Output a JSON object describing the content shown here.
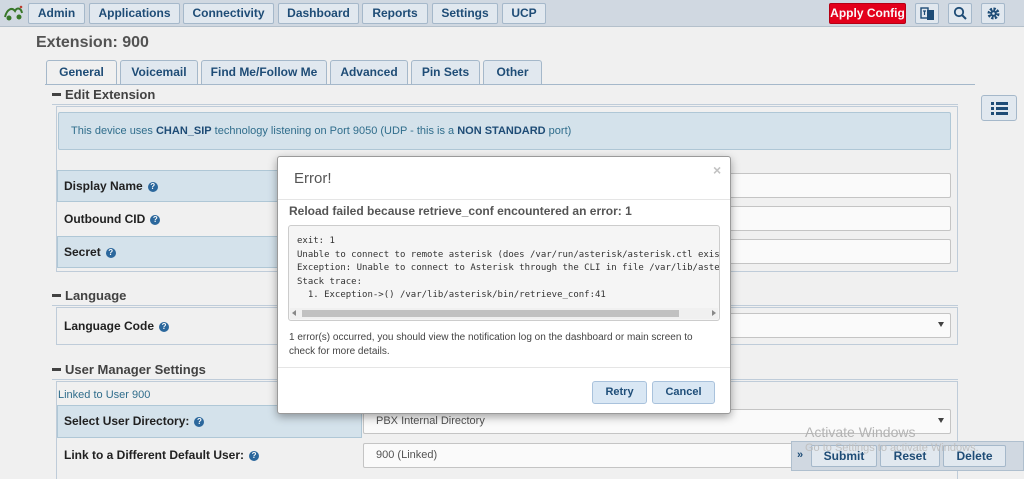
{
  "nav": {
    "items": [
      "Admin",
      "Applications",
      "Connectivity",
      "Dashboard",
      "Reports",
      "Settings",
      "UCP"
    ],
    "apply": "Apply Config"
  },
  "page": {
    "title": "Extension: 900"
  },
  "tabs": [
    "General",
    "Voicemail",
    "Find Me/Follow Me",
    "Advanced",
    "Pin Sets",
    "Other"
  ],
  "edit": {
    "heading": "Edit Extension",
    "info_pre": "This device uses ",
    "info_tech": "CHAN_SIP",
    "info_mid": " technology listening on Port 9050 (UDP - this is a ",
    "info_nonstd": "NON STANDARD",
    "info_post": " port)",
    "display_name": "Display Name",
    "outbound_cid": "Outbound CID",
    "secret": "Secret"
  },
  "language": {
    "heading": "Language",
    "label": "Language Code"
  },
  "usermgr": {
    "heading": "User Manager Settings",
    "linked": "Linked to User 900",
    "select_dir": "Select User Directory:",
    "dir_value": "PBX Internal Directory",
    "link_user": "Link to a Different Default User:",
    "link_value": "900 (Linked)"
  },
  "actions": {
    "submit": "Submit",
    "reset": "Reset",
    "delete": "Delete"
  },
  "watermark": {
    "line1": "Activate Windows",
    "line2": "Go to Settings to activate Windows."
  },
  "modal": {
    "title": "Error!",
    "close": "×",
    "subtitle": "Reload failed because retrieve_conf encountered an error: 1",
    "code": "exit: 1\nUnable to connect to remote asterisk (does /var/run/asterisk/asterisk.ctl exist?)\nException: Unable to connect to Asterisk through the CLI in file /var/lib/asterisk\nStack trace:\n  1. Exception->() /var/lib/asterisk/bin/retrieve_conf:41",
    "note": "1 error(s) occurred, you should view the notification log on the dashboard or main screen to check for more details.",
    "retry": "Retry",
    "cancel": "Cancel"
  }
}
